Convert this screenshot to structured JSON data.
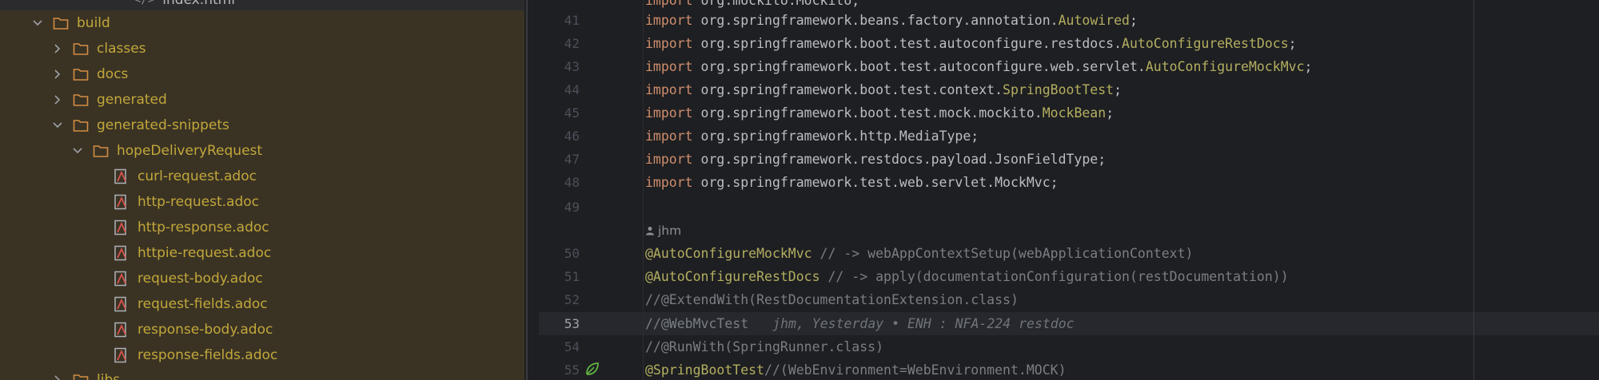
{
  "project_tree": {
    "partial_top_item": "index.html",
    "items": [
      {
        "label": "build",
        "type": "folder",
        "expanded": true
      },
      {
        "label": "classes",
        "type": "folder",
        "expanded": false
      },
      {
        "label": "docs",
        "type": "folder",
        "expanded": false
      },
      {
        "label": "generated",
        "type": "folder",
        "expanded": false
      },
      {
        "label": "generated-snippets",
        "type": "folder",
        "expanded": true
      },
      {
        "label": "hopeDeliveryRequest",
        "type": "folder",
        "expanded": true
      },
      {
        "label": "curl-request.adoc",
        "type": "file"
      },
      {
        "label": "http-request.adoc",
        "type": "file"
      },
      {
        "label": "http-response.adoc",
        "type": "file"
      },
      {
        "label": "httpie-request.adoc",
        "type": "file"
      },
      {
        "label": "request-body.adoc",
        "type": "file"
      },
      {
        "label": "request-fields.adoc",
        "type": "file"
      },
      {
        "label": "response-body.adoc",
        "type": "file"
      },
      {
        "label": "response-fields.adoc",
        "type": "file"
      },
      {
        "label": "libs",
        "type": "folder",
        "expanded": false
      }
    ]
  },
  "editor": {
    "current_line": "53",
    "author_hint": "jhm",
    "blame_annotation": "jhm, Yesterday • ENH : NFA-224 restdoc",
    "lines": [
      {
        "num": "",
        "parts": [
          "import",
          " org.mockito.Mockito;"
        ]
      },
      {
        "num": "41",
        "parts": [
          "import",
          " org.springframework.beans.factory.annotation.",
          "Autowired",
          ";"
        ]
      },
      {
        "num": "42",
        "parts": [
          "import",
          " org.springframework.boot.test.autoconfigure.restdocs.",
          "AutoConfigureRestDocs",
          ";"
        ]
      },
      {
        "num": "43",
        "parts": [
          "import",
          " org.springframework.boot.test.autoconfigure.web.servlet.",
          "AutoConfigureMockMvc",
          ";"
        ]
      },
      {
        "num": "44",
        "parts": [
          "import",
          " org.springframework.boot.test.context.",
          "SpringBootTest",
          ";"
        ]
      },
      {
        "num": "45",
        "parts": [
          "import",
          " org.springframework.boot.test.mock.mockito.",
          "MockBean",
          ";"
        ]
      },
      {
        "num": "46",
        "parts": [
          "import",
          " org.springframework.http.MediaType;"
        ]
      },
      {
        "num": "47",
        "parts": [
          "import",
          " org.springframework.restdocs.payload.JsonFieldType;"
        ]
      },
      {
        "num": "48",
        "parts": [
          "import",
          " org.springframework.test.web.servlet.MockMvc;"
        ]
      },
      {
        "num": "49",
        "parts": []
      },
      {
        "num": "50",
        "parts": [
          "@AutoConfigureMockMvc",
          " // -> webAppContextSetup(webApplicationContext)"
        ]
      },
      {
        "num": "51",
        "parts": [
          "@AutoConfigureRestDocs",
          " // -> apply(documentationConfiguration(restDocumentation))"
        ]
      },
      {
        "num": "52",
        "parts": [
          "//@ExtendWith(RestDocumentationExtension.class)"
        ]
      },
      {
        "num": "53",
        "parts": [
          "//@WebMvcTest"
        ]
      },
      {
        "num": "54",
        "parts": [
          "//@RunWith(SpringRunner.class)"
        ]
      },
      {
        "num": "55",
        "parts": [
          "@SpringBootTest",
          "//(WebEnvironment=WebEnvironment.MOCK)"
        ]
      }
    ]
  },
  "colors": {
    "keyword": "#cf8e6d",
    "annotation": "#b3ae60",
    "comment": "#7a7e85",
    "tree_text": "#c2a73a",
    "excluded_bg": "#3a3324"
  }
}
